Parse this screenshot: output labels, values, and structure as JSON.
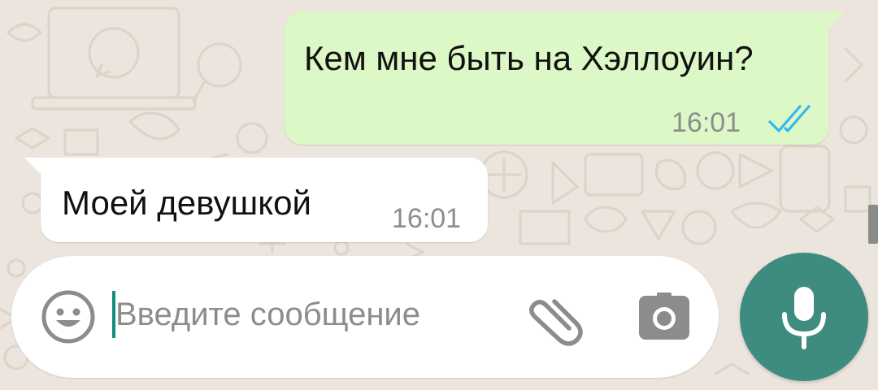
{
  "theme": {
    "wallpaper": "#ece5dd",
    "outgoing_bubble": "#dcf8c6",
    "incoming_bubble": "#ffffff",
    "read_ticks": "#34b7f1",
    "accent": "#3e8c7f"
  },
  "messages": [
    {
      "direction": "outgoing",
      "text": "Кем мне быть на Хэллоуин?",
      "time": "16:01",
      "status": "read"
    },
    {
      "direction": "incoming",
      "text": "Моей девушкой",
      "time": "16:01"
    }
  ],
  "composer": {
    "placeholder": "Введите сообщение",
    "value": "",
    "icons": [
      "emoji-icon",
      "attach-icon",
      "camera-icon"
    ],
    "send_icon": "mic-icon"
  }
}
